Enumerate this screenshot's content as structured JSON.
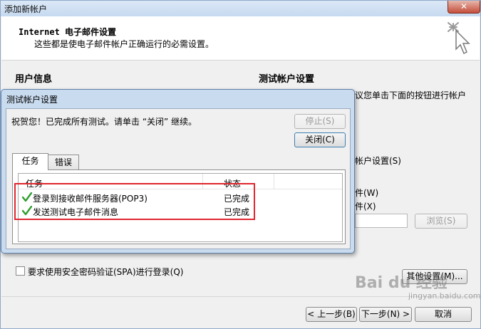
{
  "window": {
    "title": "添加新帐户",
    "close_label": "✕"
  },
  "header": {
    "title": "Internet 电子邮件设置",
    "subtitle": "这些都是使电子邮件帐户正确运行的必需设置。"
  },
  "sections": {
    "user_info": "用户信息",
    "test_settings": "测试帐户设置"
  },
  "partial_right_text": {
    "line1": "议您单击下面的按钮进行帐户",
    "line2": "帐户设置(S)",
    "line3": "件(W)",
    "line4": "件(X)"
  },
  "buttons": {
    "browse": "浏览(S)",
    "other_settings": "其他设置(M)...",
    "back": "< 上一步(B)",
    "next": "下一步(N) >",
    "cancel": "取消"
  },
  "spa": {
    "label": "要求使用安全密码验证(SPA)进行登录(Q)",
    "checked": false
  },
  "dialog": {
    "title": "测试帐户设置",
    "message": "祝贺您！已完成所有测试。请单击 “关闭” 继续。",
    "stop_button": "停止(S)",
    "close_button": "关闭(C)",
    "tabs": [
      {
        "label": "任务",
        "active": true
      },
      {
        "label": "错误",
        "active": false
      }
    ],
    "columns": [
      "任务",
      "状态"
    ],
    "rows": [
      {
        "task": "登录到接收邮件服务器(POP3)",
        "status": "已完成",
        "icon": "checkmark-icon"
      },
      {
        "task": "发送测试电子邮件消息",
        "status": "已完成",
        "icon": "checkmark-icon"
      }
    ]
  },
  "watermark": {
    "text": "Bai du 经验",
    "sub": "jingyan.baidu.com"
  },
  "colors": {
    "highlight": "#e0262e",
    "check": "#2f9e2f",
    "titlebar": "#c6d9ef"
  }
}
